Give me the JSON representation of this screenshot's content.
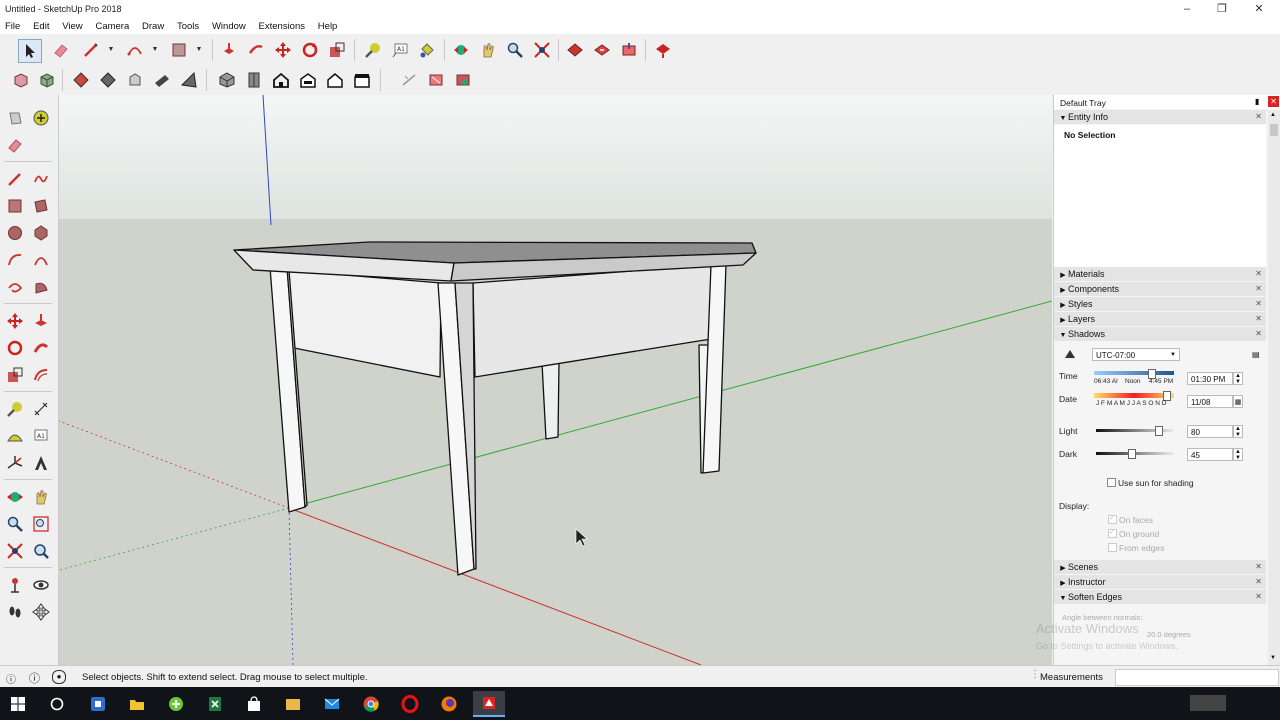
{
  "window": {
    "title": "Untitled - SketchUp Pro 2018",
    "minimize_icon": "minimize-icon",
    "maximize_icon": "restore-icon",
    "close_icon": "close-icon"
  },
  "menu": [
    "File",
    "Edit",
    "View",
    "Camera",
    "Draw",
    "Tools",
    "Window",
    "Extensions",
    "Help"
  ],
  "tray": {
    "title": "Default Tray",
    "entity_info": {
      "header": "Entity Info",
      "selection": "No Selection"
    },
    "panels_collapsed": [
      "Materials",
      "Components",
      "Styles",
      "Layers"
    ],
    "shadows": {
      "header": "Shadows",
      "timezone": "UTC-07:00",
      "time_label": "Time",
      "time_slider_start": "06:43 AI",
      "time_slider_mid": "Noon",
      "time_slider_end": "4:45 PM",
      "time_value": "01:30 PM",
      "date_label": "Date",
      "date_months": "J F M A M J J A S O N D",
      "date_value": "11/08",
      "light_label": "Light",
      "light_value": "80",
      "light_fraction": 0.8,
      "dark_label": "Dark",
      "dark_value": "45",
      "dark_fraction": 0.45,
      "use_sun_label": "Use sun for shading",
      "display_label": "Display:",
      "on_faces_label": "On faces",
      "on_ground_label": "On ground",
      "from_edges_label": "From edges"
    },
    "panels_collapsed_2": [
      "Scenes",
      "Instructor"
    ],
    "soften_edges": {
      "header": "Soften Edges",
      "angle_label": "Angle between normals:",
      "angle_value": "20.0 degrees"
    },
    "watermark_line1": "Activate Windows",
    "watermark_line2": "Go to Settings to activate Windows."
  },
  "status": {
    "message": "Select objects. Shift to extend select. Drag mouse to select multiple.",
    "measurements_label": "Measurements",
    "measurements_value": ""
  },
  "colors": {
    "sky": "#e6ece9",
    "ground": "#cfd3cb",
    "axis_red": "#cc3333",
    "axis_green": "#33aa33",
    "axis_blue": "#3344cc",
    "taskbar": "#101418"
  }
}
